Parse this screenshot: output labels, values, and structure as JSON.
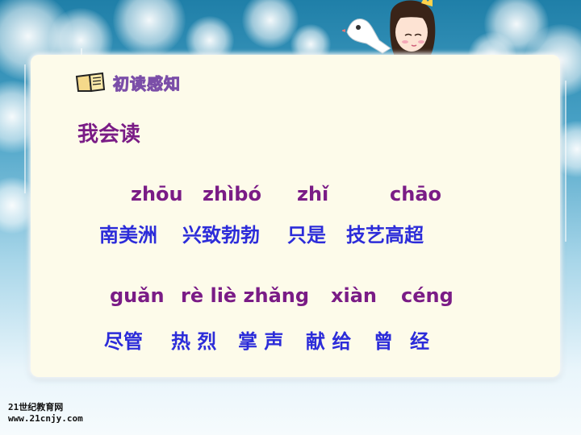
{
  "header": {
    "section_title": "初读感知"
  },
  "exercise": {
    "title": "我会读",
    "row1_pinyin": [
      "zhōu",
      "zhìbó",
      "zhǐ",
      "chāo"
    ],
    "row1_words": [
      "南美洲",
      "兴致勃勃",
      "只是",
      "技艺高超"
    ],
    "row2_pinyin": [
      "guǎn",
      "rè liè zhǎng",
      "xiàn",
      "céng"
    ],
    "row2_words": [
      "尽管",
      "热 烈",
      "掌 声",
      "献 给",
      "曾",
      "经"
    ]
  },
  "footer": {
    "logo_line1": "21世纪教育网",
    "logo_line2": "www.21cnjy.com"
  }
}
